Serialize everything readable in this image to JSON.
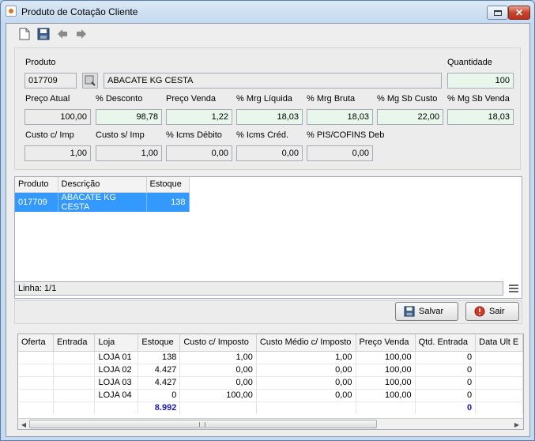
{
  "window": {
    "title": "Produto de Cotação Cliente"
  },
  "toolbar": {
    "icons": [
      "new-document-icon",
      "save-icon",
      "back-arrow-icon",
      "forward-arrow-icon"
    ]
  },
  "form": {
    "produto_label": "Produto",
    "produto_code": "017709",
    "produto_desc": "ABACATE KG CESTA",
    "quantidade_label": "Quantidade",
    "quantidade_value": "100",
    "preco_atual_label": "Preço Atual",
    "preco_atual_value": "100,00",
    "desconto_label": "% Desconto",
    "desconto_value": "98,78",
    "preco_venda_label": "Preço Venda",
    "preco_venda_value": "1,22",
    "mrg_liquida_label": "% Mrg Líquida",
    "mrg_liquida_value": "18,03",
    "mrg_bruta_label": "% Mrg Bruta",
    "mrg_bruta_value": "18,03",
    "mg_sb_custo_label": "% Mg Sb Custo",
    "mg_sb_custo_value": "22,00",
    "mg_sb_venda_label": "% Mg Sb Venda",
    "mg_sb_venda_value": "18,03",
    "custo_c_imp_label": "Custo c/ Imp",
    "custo_c_imp_value": "1,00",
    "custo_s_imp_label": "Custo s/ Imp",
    "custo_s_imp_value": "1,00",
    "icms_debito_label": "% Icms Débito",
    "icms_debito_value": "0,00",
    "icms_cred_label": "% Icms Créd.",
    "icms_cred_value": "0,00",
    "pis_cofins_label": "% PIS/COFINS Deb",
    "pis_cofins_value": "0,00"
  },
  "grid1": {
    "headers": [
      "Produto",
      "Descrição",
      "Estoque"
    ],
    "rows": [
      {
        "produto": "017709",
        "descricao": "ABACATE KG CESTA",
        "estoque": "138"
      }
    ]
  },
  "status": {
    "linha": "Linha: 1/1"
  },
  "buttons": {
    "salvar": "Salvar",
    "sair": "Sair"
  },
  "grid2": {
    "headers": [
      "Oferta",
      "Entrada",
      "Loja",
      "Estoque",
      "Custo c/ Imposto",
      "Custo Médio c/ Imposto",
      "Preço Venda",
      "Qtd. Entrada",
      "Data Ult E"
    ],
    "rows": [
      {
        "oferta": "",
        "entrada": "",
        "loja": "LOJA 01",
        "estoque": "138",
        "custo": "1,00",
        "custo_medio": "1,00",
        "preco_venda": "100,00",
        "qtd_entrada": "0",
        "data": ""
      },
      {
        "oferta": "",
        "entrada": "",
        "loja": "LOJA 02",
        "estoque": "4.427",
        "custo": "0,00",
        "custo_medio": "0,00",
        "preco_venda": "100,00",
        "qtd_entrada": "0",
        "data": ""
      },
      {
        "oferta": "",
        "entrada": "",
        "loja": "LOJA 03",
        "estoque": "4.427",
        "custo": "0,00",
        "custo_medio": "0,00",
        "preco_venda": "100,00",
        "qtd_entrada": "0",
        "data": ""
      },
      {
        "oferta": "",
        "entrada": "",
        "loja": "LOJA 04",
        "estoque": "0",
        "custo": "100,00",
        "custo_medio": "0,00",
        "preco_venda": "100,00",
        "qtd_entrada": "0",
        "data": ""
      }
    ],
    "total_estoque": "8.992",
    "total_qtd_entrada": "0"
  }
}
